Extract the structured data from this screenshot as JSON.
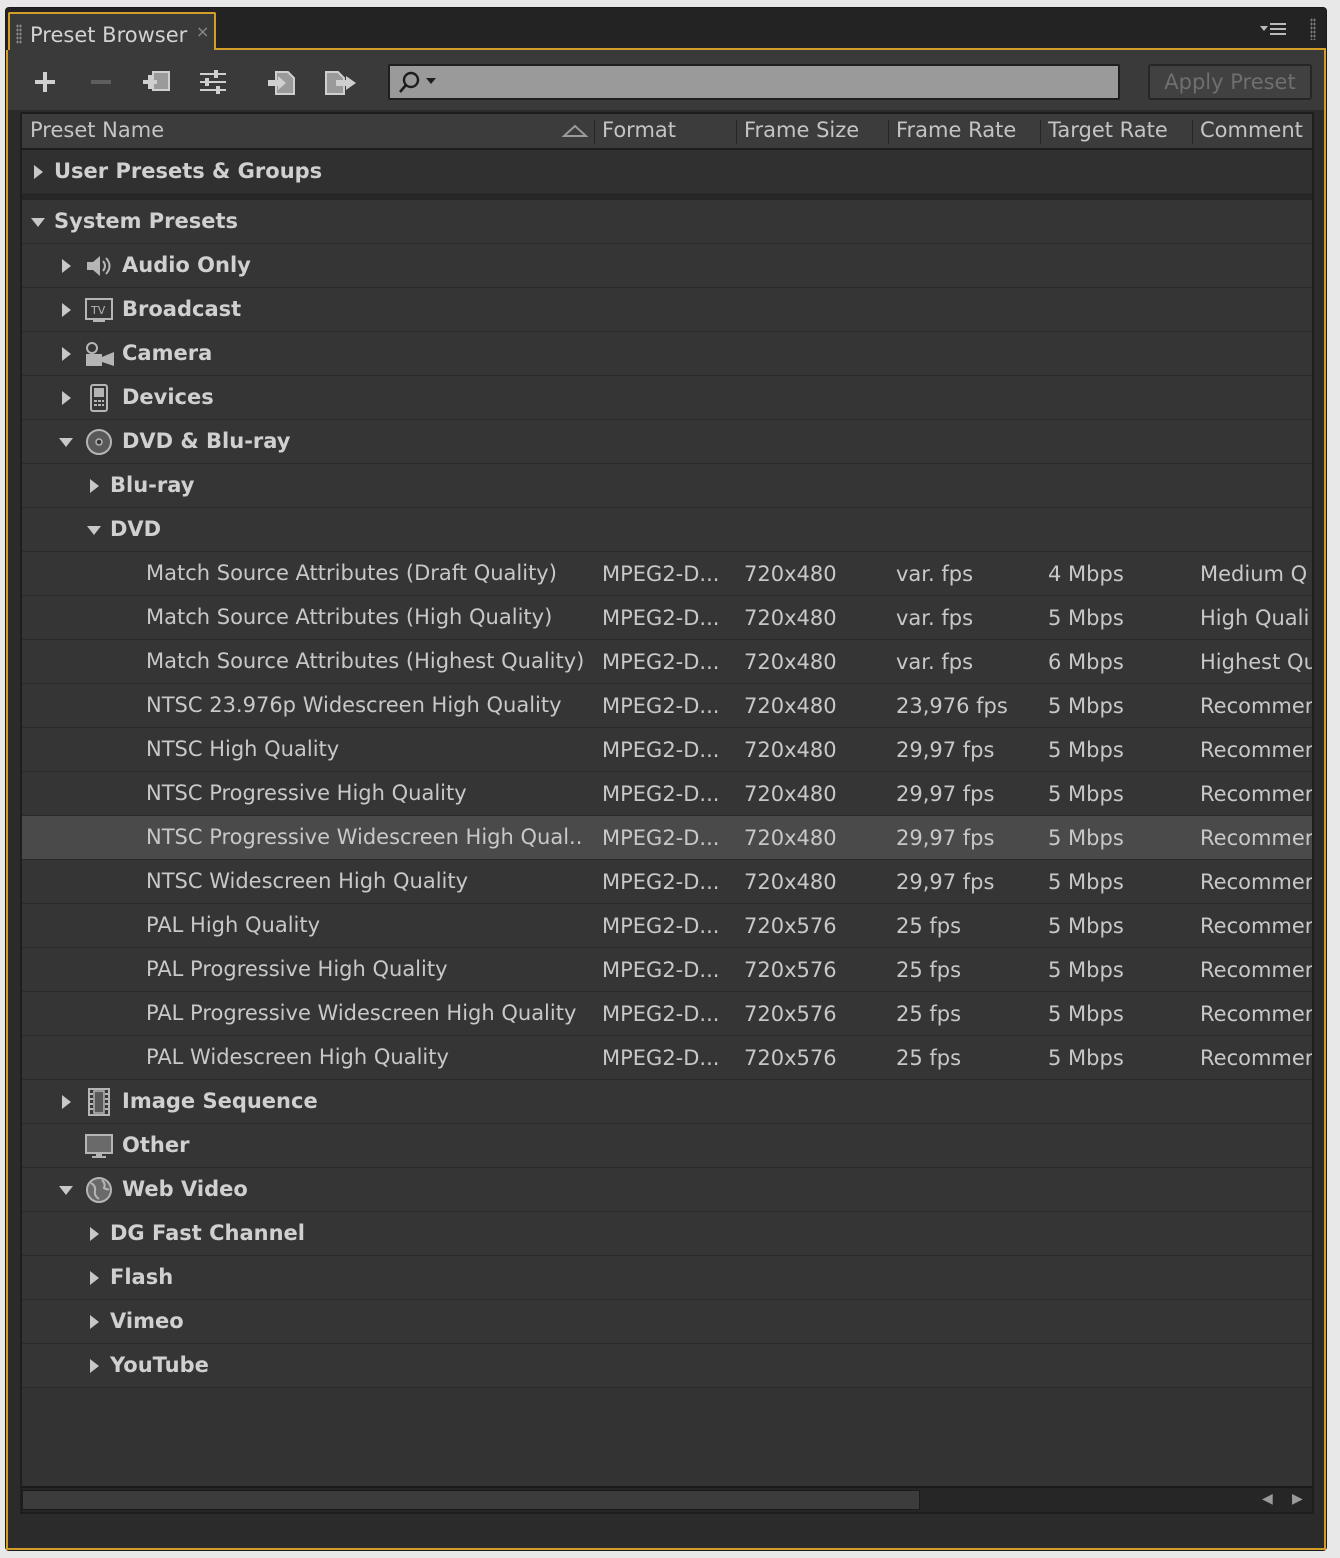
{
  "panel": {
    "tab_label": "Preset Browser",
    "tab_close": "×",
    "menu_icon": "☰"
  },
  "toolbar": {
    "search_placeholder": "",
    "apply_label": "Apply Preset"
  },
  "columns": {
    "name": "Preset Name",
    "format": "Format",
    "frame_size": "Frame Size",
    "frame_rate": "Frame Rate",
    "target_rate": "Target Rate",
    "comment": "Comment"
  },
  "tree": {
    "user_presets": "User Presets & Groups",
    "system_presets": "System Presets",
    "audio_only": "Audio Only",
    "broadcast": "Broadcast",
    "camera": "Camera",
    "devices": "Devices",
    "dvd_bluray": "DVD & Blu-ray",
    "bluray": "Blu-ray",
    "dvd": "DVD",
    "image_sequence": "Image Sequence",
    "other": "Other",
    "web_video": "Web Video",
    "dg_fast_channel": "DG Fast Channel",
    "flash": "Flash",
    "vimeo": "Vimeo",
    "youtube": "YouTube"
  },
  "dvd_presets": [
    {
      "name": "Match Source Attributes (Draft Quality)",
      "format": "MPEG2-D...",
      "frame_size": "720x480",
      "frame_rate": "var. fps",
      "target_rate": "4 Mbps",
      "comment": "Medium Q"
    },
    {
      "name": "Match Source Attributes (High Quality)",
      "format": "MPEG2-D...",
      "frame_size": "720x480",
      "frame_rate": "var. fps",
      "target_rate": "5 Mbps",
      "comment": "High Quali"
    },
    {
      "name": "Match Source Attributes (Highest Quality)",
      "format": "MPEG2-D...",
      "frame_size": "720x480",
      "frame_rate": "var. fps",
      "target_rate": "6 Mbps",
      "comment": "Highest Qu"
    },
    {
      "name": "NTSC 23.976p Widescreen High Quality",
      "format": "MPEG2-D...",
      "frame_size": "720x480",
      "frame_rate": "23,976 fps",
      "target_rate": "5 Mbps",
      "comment": "Recommer"
    },
    {
      "name": "NTSC High Quality",
      "format": "MPEG2-D...",
      "frame_size": "720x480",
      "frame_rate": "29,97 fps",
      "target_rate": "5 Mbps",
      "comment": "Recommer"
    },
    {
      "name": "NTSC Progressive High Quality",
      "format": "MPEG2-D...",
      "frame_size": "720x480",
      "frame_rate": "29,97 fps",
      "target_rate": "5 Mbps",
      "comment": "Recommer"
    },
    {
      "name": "NTSC Progressive Widescreen High Qual..",
      "format": "MPEG2-D...",
      "frame_size": "720x480",
      "frame_rate": "29,97 fps",
      "target_rate": "5 Mbps",
      "comment": "Recommer"
    },
    {
      "name": "NTSC Widescreen High Quality",
      "format": "MPEG2-D...",
      "frame_size": "720x480",
      "frame_rate": "29,97 fps",
      "target_rate": "5 Mbps",
      "comment": "Recommer"
    },
    {
      "name": "PAL High Quality",
      "format": "MPEG2-D...",
      "frame_size": "720x576",
      "frame_rate": "25 fps",
      "target_rate": "5 Mbps",
      "comment": "Recommer"
    },
    {
      "name": "PAL Progressive High Quality",
      "format": "MPEG2-D...",
      "frame_size": "720x576",
      "frame_rate": "25 fps",
      "target_rate": "5 Mbps",
      "comment": "Recommer"
    },
    {
      "name": "PAL Progressive Widescreen High Quality",
      "format": "MPEG2-D...",
      "frame_size": "720x576",
      "frame_rate": "25 fps",
      "target_rate": "5 Mbps",
      "comment": "Recommer"
    },
    {
      "name": "PAL Widescreen High Quality",
      "format": "MPEG2-D...",
      "frame_size": "720x576",
      "frame_rate": "25 fps",
      "target_rate": "5 Mbps",
      "comment": "Recommer"
    }
  ],
  "colors": {
    "panel_bg": "#2b2b2b",
    "accent": "#d29e28",
    "row_bg": "#353535",
    "selected_row": "#4a4a4a"
  },
  "icons": {
    "add": "plus-icon",
    "remove": "minus-icon",
    "new_group": "new-group-icon",
    "settings": "settings-icon",
    "import": "import-icon",
    "export": "export-icon",
    "search": "search-icon"
  }
}
